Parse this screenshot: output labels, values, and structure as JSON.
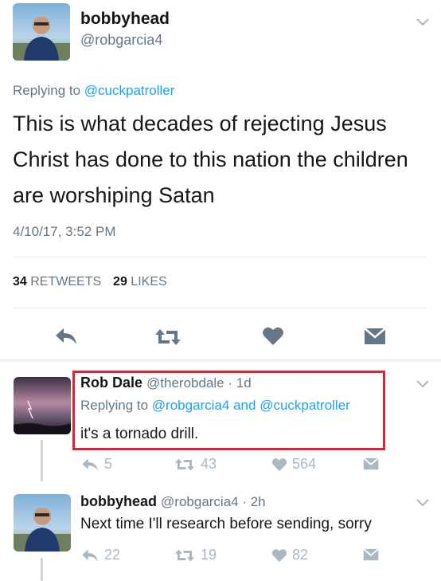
{
  "main_tweet": {
    "display_name": "bobbyhead",
    "handle": "@robgarcia4",
    "replying_prefix": "Replying to ",
    "replying_to": "@cuckpatroller",
    "text": "This is what decades of rejecting Jesus Christ has done to this nation the children are worshiping Satan",
    "timestamp": "4/10/17, 3:52 PM",
    "retweets_count": "34",
    "retweets_label": "RETWEETS",
    "likes_count": "29",
    "likes_label": "LIKES"
  },
  "reply1": {
    "display_name": "Rob Dale",
    "handle_time": "@therobdale · 1d",
    "replying_prefix": "Replying to ",
    "replying_to_1": "@robgarcia4",
    "and_text": " and ",
    "replying_to_2": "@cuckpatroller",
    "text": "it's a tornado drill.",
    "reply_count": "5",
    "retweet_count": "43",
    "like_count": "564",
    "highlight_color": "#e0232e"
  },
  "reply2": {
    "display_name": "bobbyhead",
    "handle_time": "@robgarcia4 · 2h",
    "text": "Next time I'll research before sending, sorry",
    "reply_count": "22",
    "retweet_count": "19",
    "like_count": "82"
  },
  "colors": {
    "action_icon": "#657786",
    "action_icon_small": "#aab8c2",
    "link": "#1da1f2"
  }
}
